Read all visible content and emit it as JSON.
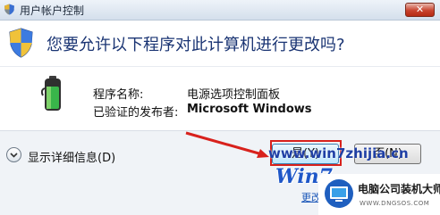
{
  "window": {
    "title": "用户帐户控制",
    "close_label": "✕"
  },
  "prompt": {
    "question": "您要允许以下程序对此计算机进行更改吗?"
  },
  "details": {
    "program_name_label": "程序名称:",
    "program_name_value": "电源选项控制面板",
    "publisher_label": "已验证的发布者:",
    "publisher_value": "Microsoft Windows"
  },
  "footer": {
    "show_details_label": "显示详细信息(D)",
    "yes_button": "是(Y)",
    "no_button": "否(N)",
    "change_link": "更改"
  },
  "watermark": {
    "url": "www.win7zhijia.cn",
    "logo": "Win7",
    "brand_name": "电脑公司装机大师",
    "brand_url": "WWW.DNGSOS.COM"
  },
  "colors": {
    "question_text": "#1a3473",
    "highlight": "#d8211c",
    "titlebar": "#d4dfec"
  },
  "icons": {
    "title": "uac-shield-icon",
    "prompt": "uac-shield-icon",
    "program": "battery-power-icon",
    "expander": "chevron-down-icon"
  }
}
